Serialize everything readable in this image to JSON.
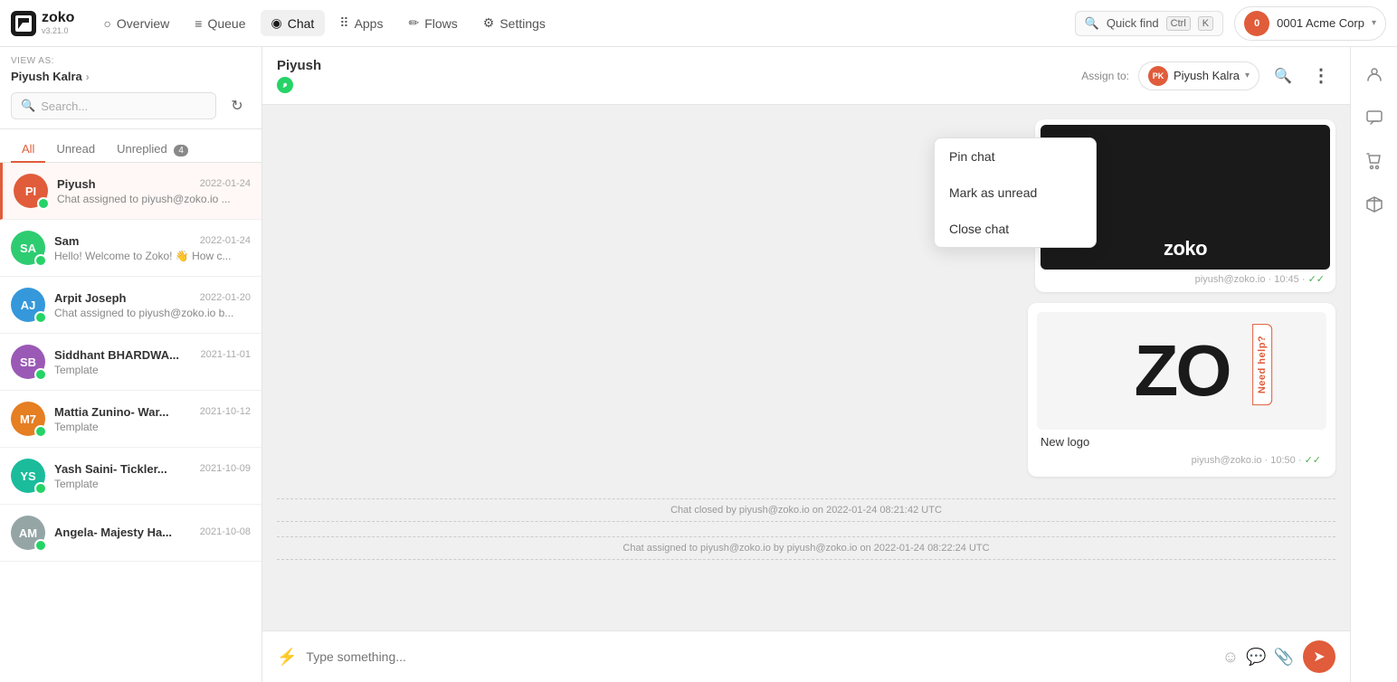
{
  "app": {
    "logo_text": "zoko",
    "logo_version": "v3.21.0"
  },
  "nav": {
    "items": [
      {
        "id": "overview",
        "label": "Overview",
        "icon": "○",
        "active": false
      },
      {
        "id": "queue",
        "label": "Queue",
        "icon": "≡",
        "active": false
      },
      {
        "id": "chat",
        "label": "Chat",
        "icon": "◉",
        "active": true
      },
      {
        "id": "apps",
        "label": "Apps",
        "icon": "⠿",
        "active": false
      },
      {
        "id": "flows",
        "label": "Flows",
        "icon": "✏",
        "active": false
      },
      {
        "id": "settings",
        "label": "Settings",
        "icon": "⚙",
        "active": false
      }
    ],
    "quick_find": "Quick find",
    "ctrl_key": "Ctrl",
    "k_key": "K",
    "account": "0001 Acme Corp",
    "account_initials": "0"
  },
  "sidebar": {
    "view_as_label": "VIEW AS:",
    "view_as_user": "Piyush Kalra",
    "search_placeholder": "Search...",
    "tabs": [
      {
        "id": "all",
        "label": "All",
        "active": true,
        "badge": null
      },
      {
        "id": "unread",
        "label": "Unread",
        "active": false,
        "badge": null
      },
      {
        "id": "unreplied",
        "label": "Unreplied",
        "active": false,
        "badge": "4"
      }
    ],
    "chats": [
      {
        "id": "piyush",
        "name": "Piyush",
        "initials": "PI",
        "color": "#e05c3a",
        "date": "2022-01-24",
        "preview": "Chat assigned to piyush@zoko.io ...",
        "active": true
      },
      {
        "id": "sam",
        "name": "Sam",
        "initials": "SA",
        "color": "#2ecc71",
        "date": "2022-01-24",
        "preview": "Hello! Welcome to Zoko! 👋 How c...",
        "active": false
      },
      {
        "id": "arpit",
        "name": "Arpit Joseph",
        "initials": "AJ",
        "color": "#3498db",
        "date": "2022-01-20",
        "preview": "Chat assigned to piyush@zoko.io b...",
        "active": false
      },
      {
        "id": "siddhant",
        "name": "Siddhant BHARDWA...",
        "initials": "SB",
        "color": "#9b59b6",
        "date": "2021-11-01",
        "preview": "Template",
        "active": false
      },
      {
        "id": "mattia",
        "name": "Mattia Zunino- War...",
        "initials": "M7",
        "color": "#e67e22",
        "date": "2021-10-12",
        "preview": "Template",
        "active": false
      },
      {
        "id": "yash",
        "name": "Yash Saini- Tickler...",
        "initials": "YS",
        "color": "#1abc9c",
        "date": "2021-10-09",
        "preview": "Template",
        "active": false
      },
      {
        "id": "angela",
        "name": "Angela- Majesty Ha...",
        "initials": "AM",
        "color": "#95a5a6",
        "date": "2021-10-08",
        "preview": "",
        "active": false
      }
    ]
  },
  "chat_header": {
    "contact_name": "Piyush",
    "assign_label": "Assign to:",
    "assigned_to": "Piyush Kalra",
    "assigned_initials": "PK"
  },
  "dropdown_menu": {
    "items": [
      {
        "id": "pin-chat",
        "label": "Pin chat"
      },
      {
        "id": "mark-unread",
        "label": "Mark as unread"
      },
      {
        "id": "close-chat",
        "label": "Close chat"
      }
    ]
  },
  "messages": [
    {
      "id": "msg1",
      "type": "image",
      "image_text": "zoko",
      "sent_by": "piyush@zoko.io",
      "time": "10:45",
      "ticks": "✓✓"
    },
    {
      "id": "msg2",
      "type": "image-text",
      "image_text": "ZO",
      "caption": "New logo",
      "sent_by": "piyush@zoko.io",
      "time": "10:50",
      "ticks": "✓✓"
    }
  ],
  "system_messages": [
    "Chat closed by piyush@zoko.io on 2022-01-24 08:21:42 UTC",
    "Chat assigned to piyush@zoko.io by piyush@zoko.io on 2022-01-24 08:22:24 UTC"
  ],
  "input": {
    "placeholder": "Type something..."
  },
  "need_help": "Need help?"
}
